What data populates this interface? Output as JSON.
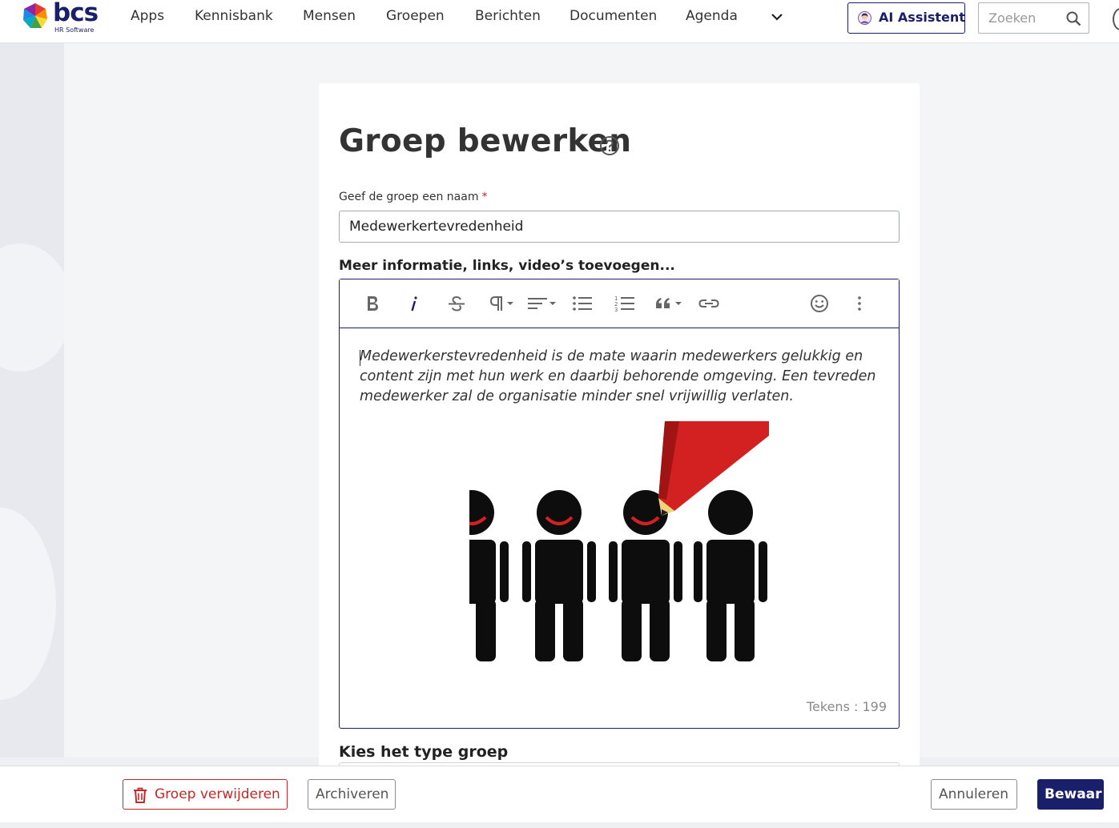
{
  "brand": {
    "logo_text": "bcs",
    "logo_subtext": "HR Software"
  },
  "nav": {
    "items": [
      "Apps",
      "Kennisbank",
      "Mensen",
      "Groepen",
      "Berichten",
      "Documenten",
      "Agenda"
    ],
    "more_icon": "chevron-down-icon",
    "ai_button_label": "AI Assistent",
    "ai_button_icon": "ai-assistant-icon",
    "search_placeholder": "Zoeken",
    "search_icon": "search-icon"
  },
  "page": {
    "title": "Groep bewerken",
    "help_icon": "help-circle-icon"
  },
  "form": {
    "name_label": "Geef de groep een naam",
    "required_marker": "*",
    "name_value": "Medewerkertevredenheid",
    "info_label": "Meer informatie, links, video’s toevoegen...",
    "editor": {
      "toolbar": [
        "bold-icon",
        "italic-icon",
        "strikethrough-icon",
        "paragraph-format-icon",
        "align-icon",
        "bulleted-list-icon",
        "numbered-list-icon",
        "quote-icon",
        "link-icon",
        "emoji-icon",
        "more-vertical-icon"
      ],
      "content": "Medewerkerstevredenheid is de mate waarin medewerkers gelukkig en content zijn met hun werk en daarbij behorende omgeving. Een tevreden medewerker zal de organisatie minder snel vrijwillig verlaten.",
      "image": "smiley-figures-with-red-pencil-illustration",
      "char_count_label": "Tekens : 199"
    },
    "type_label": "Kies het type groep"
  },
  "footer": {
    "delete_label": "Groep verwijderen",
    "delete_icon": "trash-icon",
    "archive_label": "Archiveren",
    "cancel_label": "Annuleren",
    "save_label": "Bewaar"
  },
  "colors": {
    "brand_navy": "#1a1f6b",
    "danger": "#c62828",
    "pencil_red": "#d32020"
  }
}
